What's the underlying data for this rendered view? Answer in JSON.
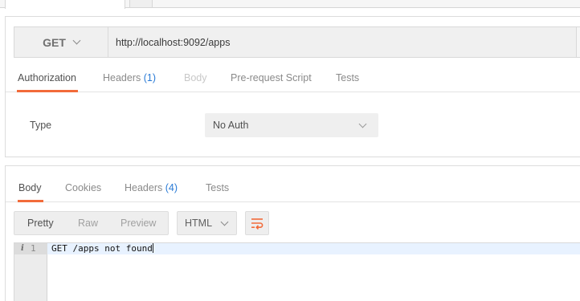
{
  "request": {
    "method": "GET",
    "url": "http://localhost:9092/apps",
    "tabs": [
      {
        "label": "Authorization",
        "count": ""
      },
      {
        "label": "Headers",
        "count": "(1)"
      },
      {
        "label": "Body",
        "count": ""
      },
      {
        "label": "Pre-request Script",
        "count": ""
      },
      {
        "label": "Tests",
        "count": ""
      }
    ],
    "auth": {
      "type_label": "Type",
      "type_value": "No Auth"
    }
  },
  "response": {
    "tabs": [
      {
        "label": "Body",
        "count": ""
      },
      {
        "label": "Cookies",
        "count": ""
      },
      {
        "label": "Headers",
        "count": "(4)"
      },
      {
        "label": "Tests",
        "count": ""
      }
    ],
    "view_modes": [
      "Pretty",
      "Raw",
      "Preview"
    ],
    "format": "HTML",
    "editor": {
      "info_glyph": "i",
      "line_number": "1",
      "code": "GET /apps not found"
    }
  },
  "colors": {
    "accent": "#f26b3a",
    "count_blue": "#2a7bd6"
  },
  "icons": [
    "chevron-down-icon",
    "wrap-lines-icon",
    "info-icon"
  ]
}
